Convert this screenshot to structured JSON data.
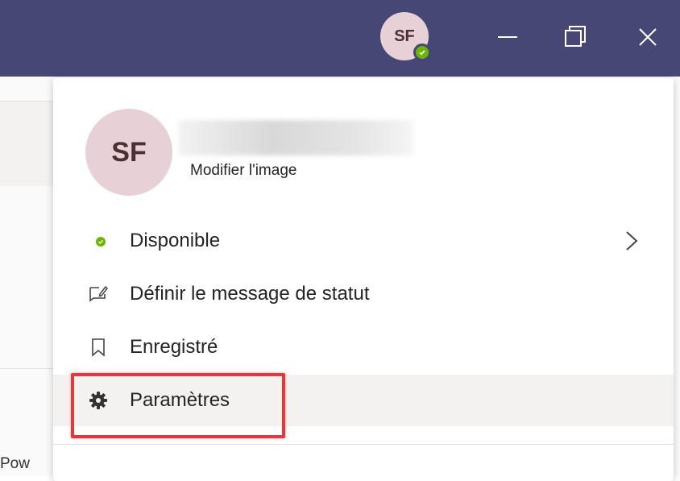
{
  "titlebar": {
    "avatar_initials": "SF",
    "status_color": "#6bb700",
    "icons": [
      "minimize-icon",
      "maximize-icon",
      "close-icon"
    ]
  },
  "background": {
    "partial_text": "Pow"
  },
  "profile": {
    "initials": "SF",
    "name_redacted": "",
    "edit_image_label": "Modifier l'image"
  },
  "menu": {
    "items": [
      {
        "label": "Disponible",
        "icon": "status-available-icon",
        "has_submenu": true
      },
      {
        "label": "Définir le message de statut",
        "icon": "edit-message-icon",
        "has_submenu": false
      },
      {
        "label": "Enregistré",
        "icon": "bookmark-icon",
        "has_submenu": false
      },
      {
        "label": "Paramètres",
        "icon": "gear-icon",
        "has_submenu": false,
        "highlighted": true
      }
    ]
  },
  "colors": {
    "titlebar": "#464775",
    "available": "#6bb700",
    "highlight_annotation": "#e0393e",
    "hover": "#f3f2f1"
  }
}
